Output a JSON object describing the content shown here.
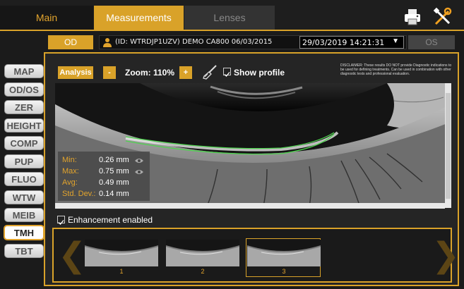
{
  "tabs": [
    {
      "label": "Main"
    },
    {
      "label": "Measurements"
    },
    {
      "label": "Lenses"
    }
  ],
  "header_icons": [
    "printer-icon",
    "tools-icon"
  ],
  "patient": {
    "od_label": "OD",
    "os_label": "OS",
    "info": "(ID: WTRDJP1UZV) DEMO CA800 06/03/2015",
    "exam_date": "29/03/2019 14:21:31"
  },
  "nav": [
    "MAP",
    "OD/OS",
    "ZER",
    "HEIGHT",
    "COMP",
    "PUP",
    "FLUO",
    "WTW",
    "MEIB",
    "TMH",
    "TBT"
  ],
  "nav_active": "TMH",
  "toolbar": {
    "analysis_label": "Analysis",
    "minus_label": "-",
    "plus_label": "+",
    "zoom_label": "Zoom:",
    "zoom_value": "110%",
    "show_profile_label": "Show profile",
    "show_profile_checked": true
  },
  "disclaimer": "DISCLAIMER: These results DO NOT provide Diagnostic indications to be used for defining treatments. Can be used in combination with other diagnostic tests and professional evaluation.",
  "stats": [
    {
      "label": "Min:",
      "value": "0.26 mm",
      "icon": "eye-icon"
    },
    {
      "label": "Max:",
      "value": "0.75 mm",
      "icon": "eye-icon"
    },
    {
      "label": "Avg:",
      "value": "0.49 mm"
    },
    {
      "label": "Std. Dev.:",
      "value": "0.14 mm"
    }
  ],
  "enhancement": {
    "label": "Enhancement enabled",
    "checked": true
  },
  "thumbnails": [
    {
      "label": "1",
      "selected": false
    },
    {
      "label": "2",
      "selected": false
    },
    {
      "label": "3",
      "selected": true
    }
  ],
  "colors": {
    "accent": "#d9a229",
    "profile_line": "#4ed34e"
  }
}
